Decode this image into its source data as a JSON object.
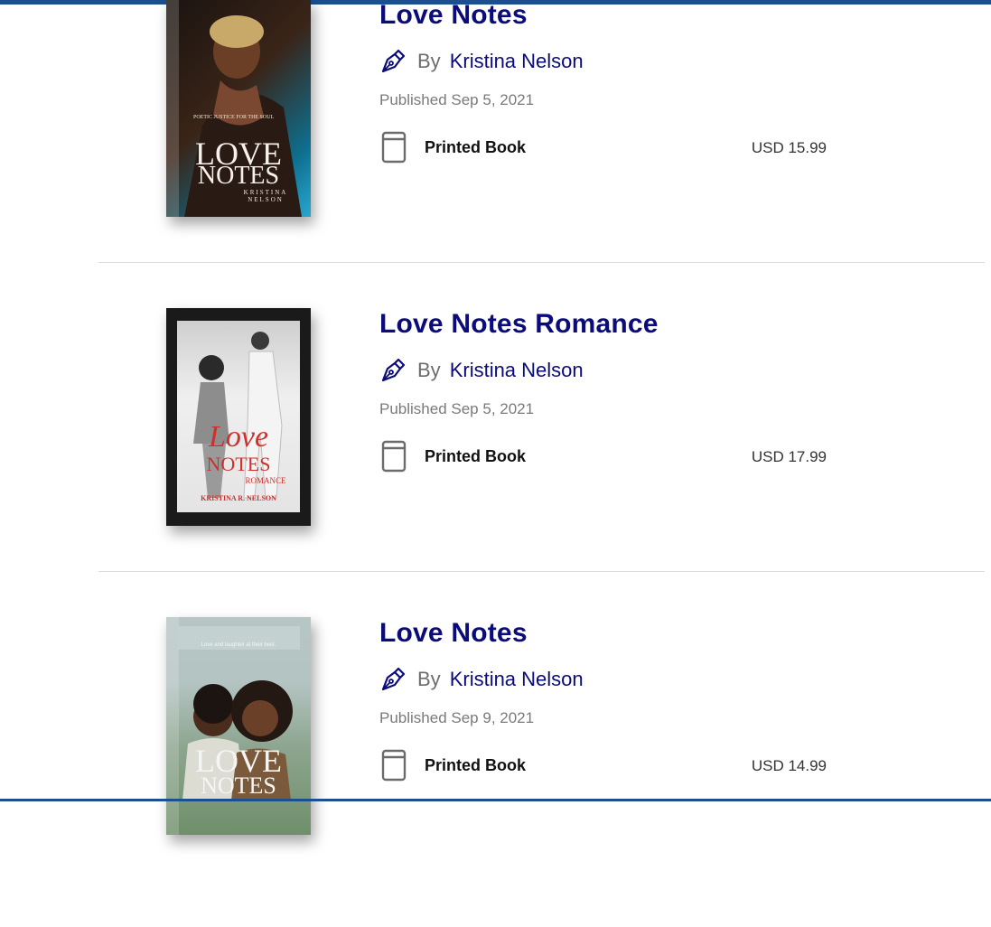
{
  "colors": {
    "accent_bar": "#1c4f8f",
    "title": "#0b0c7a",
    "author": "#0b0c7a",
    "muted": "#7a7a7a"
  },
  "labels": {
    "by": "By",
    "format_icon": "book-icon",
    "author_icon": "pen-nib-icon"
  },
  "books": [
    {
      "title": "Love Notes",
      "author": "Kristina Nelson",
      "published": "Published Sep 5, 2021",
      "format": "Printed Book",
      "price": "USD 15.99",
      "cover": {
        "tagline": "POETIC JUSTICE FOR THE SOUL",
        "line1": "LOVE",
        "line2": "NOTES",
        "author": "KRISTINA NELSON"
      }
    },
    {
      "title": "Love Notes Romance",
      "author": "Kristina Nelson",
      "published": "Published Sep 5, 2021",
      "format": "Printed Book",
      "price": "USD 17.99",
      "cover": {
        "line1": "Love",
        "line2": "NOTES",
        "line3": "ROMANCE",
        "author": "KRISTINA R. NELSON"
      }
    },
    {
      "title": "Love Notes",
      "author": "Kristina Nelson",
      "published": "Published Sep 9, 2021",
      "format": "Printed Book",
      "price": "USD 14.99",
      "cover": {
        "tagline": "Love and laughter at their best.",
        "line1": "LOVE",
        "line2": "NOTES"
      }
    }
  ]
}
